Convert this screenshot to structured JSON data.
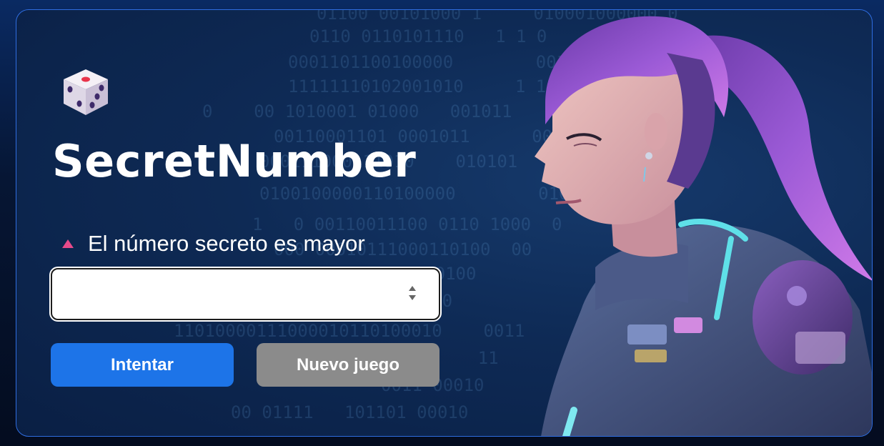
{
  "app": {
    "title": "SecretNumber"
  },
  "hint": {
    "text": "El número secreto es mayor",
    "icon": "triangle-up-icon",
    "color": "#e64a8a"
  },
  "guess_input": {
    "value": "",
    "placeholder": ""
  },
  "buttons": {
    "try_label": "Intentar",
    "new_game_label": "Nuevo juego"
  },
  "colors": {
    "primary": "#1d74e8",
    "secondary": "#8b8b8b",
    "card_border": "#2f6de0"
  },
  "icons": {
    "logo": "dice-icon",
    "hero": "astronaut-woman-illustration"
  }
}
